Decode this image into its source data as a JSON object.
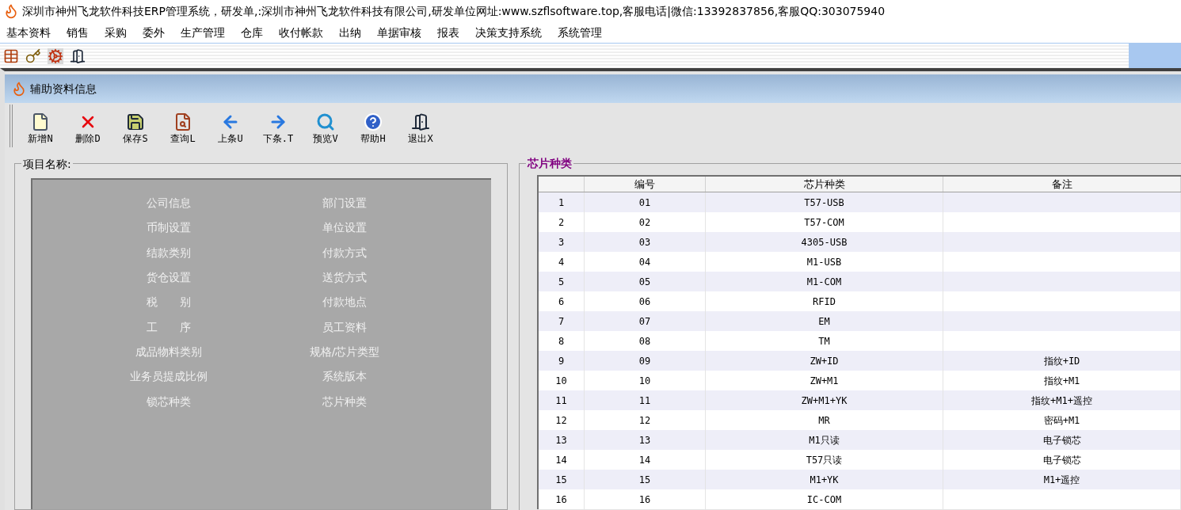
{
  "window": {
    "title": "深圳市神州飞龙软件科技ERP管理系统，研发单,:深圳市神州飞龙软件科技有限公司,研发单位网址:www.szflsoftware.top,客服电话|微信:13392837856,客服QQ:303075940"
  },
  "menu": [
    "基本资料",
    "销售",
    "采购",
    "委外",
    "生产管理",
    "仓库",
    "收付帐款",
    "出纳",
    "单据审核",
    "报表",
    "决策支持系统",
    "系统管理"
  ],
  "main_toolbar": [
    {
      "kind": "grid"
    },
    {
      "kind": "key"
    },
    {
      "kind": "gear"
    },
    {
      "kind": "exit"
    }
  ],
  "child_window": {
    "title": "辅助资料信息"
  },
  "toolbar": [
    {
      "kind": "new",
      "label": "新增N"
    },
    {
      "kind": "delete",
      "label": "删除D"
    },
    {
      "kind": "save",
      "label": "保存S"
    },
    {
      "kind": "query",
      "label": "查询L"
    },
    {
      "kind": "prev",
      "label": "上条U"
    },
    {
      "kind": "next",
      "label": "下条.T"
    },
    {
      "kind": "preview",
      "label": "预览V"
    },
    {
      "kind": "help",
      "label": "帮助H"
    },
    {
      "kind": "exit",
      "label": "退出X"
    }
  ],
  "items_panel": {
    "title": "项目名称:",
    "items": [
      [
        "公司信息",
        "部门设置"
      ],
      [
        "币制设置",
        "单位设置"
      ],
      [
        "结款类别",
        "付款方式"
      ],
      [
        "货仓设置",
        "送货方式"
      ],
      [
        "税　　别",
        "付款地点"
      ],
      [
        "工　　序",
        "员工资料"
      ],
      [
        "成品物料类别",
        "规格/芯片类型"
      ],
      [
        "业务员提成比例",
        "系统版本"
      ],
      [
        "锁芯种类",
        "芯片种类"
      ]
    ]
  },
  "grid_panel": {
    "title": "芯片种类",
    "columns": [
      "",
      "编号",
      "芯片种类",
      "备注"
    ],
    "rows": [
      [
        "1",
        "01",
        "T57-USB",
        ""
      ],
      [
        "2",
        "02",
        "T57-COM",
        ""
      ],
      [
        "3",
        "03",
        "4305-USB",
        ""
      ],
      [
        "4",
        "04",
        "M1-USB",
        ""
      ],
      [
        "5",
        "05",
        "M1-COM",
        ""
      ],
      [
        "6",
        "06",
        "RFID",
        ""
      ],
      [
        "7",
        "07",
        "EM",
        ""
      ],
      [
        "8",
        "08",
        "TM",
        ""
      ],
      [
        "9",
        "09",
        "ZW+ID",
        "指纹+ID"
      ],
      [
        "10",
        "10",
        "ZW+M1",
        "指纹+M1"
      ],
      [
        "11",
        "11",
        "ZW+M1+YK",
        "指纹+M1+遥控"
      ],
      [
        "12",
        "12",
        "MR",
        "密码+M1"
      ],
      [
        "13",
        "13",
        "M1只读",
        "电子锁芯"
      ],
      [
        "14",
        "14",
        "T57只读",
        "电子锁芯"
      ],
      [
        "15",
        "15",
        "M1+YK",
        "M1+遥控"
      ],
      [
        "16",
        "16",
        "IC-COM",
        ""
      ]
    ]
  }
}
